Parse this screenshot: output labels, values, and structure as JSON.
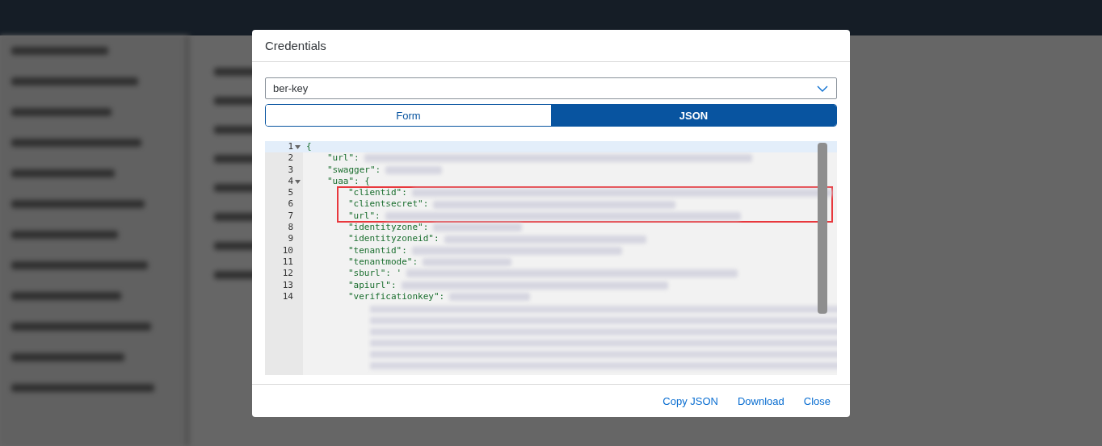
{
  "dialog": {
    "title": "Credentials",
    "key_select": {
      "value": "ber-key"
    },
    "tabs": [
      {
        "label": "Form",
        "selected": false
      },
      {
        "label": "JSON",
        "selected": true
      }
    ],
    "code": [
      {
        "number": "1",
        "text": "{",
        "expanded": true,
        "children": [
          {
            "number": "2",
            "text": "\"url\":",
            "redacted": true
          },
          {
            "number": "3",
            "text": "\"swagger\":",
            "redacted": true
          },
          {
            "number": "4",
            "text": "\"uaa\": {",
            "expanded": true,
            "children": [
              {
                "number": "5",
                "text": "\"clientid\":",
                "redacted": true,
                "highlighted": true
              },
              {
                "number": "6",
                "text": "\"clientsecret\":",
                "redacted": true,
                "highlighted": true
              },
              {
                "number": "7",
                "text": "\"url\":",
                "redacted": true,
                "highlighted": true
              },
              {
                "number": "8",
                "text": "\"identityzone\":",
                "redacted": true,
                "highlighted": false
              },
              {
                "number": "9",
                "text": "\"identityzoneid\":",
                "redacted": true,
                "highlighted": false
              },
              {
                "number": "10",
                "text": "\"tenantid\":",
                "redacted": true,
                "highlighted": false
              },
              {
                "number": "11",
                "text": "\"tenantmode\":",
                "redacted": true,
                "highlighted": false
              },
              {
                "number": "12",
                "text": "\"sburl\": '",
                "redacted": true,
                "highlighted": false
              },
              {
                "number": "13",
                "text": "\"apiurl\":",
                "redacted": true,
                "highlighted": false
              },
              {
                "number": "14",
                "text": "\"verificationkey\":",
                "redacted": true,
                "highlighted": false
              }
            ]
          }
        ]
      }
    ],
    "buttons": [
      "Copy JSON",
      "Download",
      "Close"
    ]
  }
}
